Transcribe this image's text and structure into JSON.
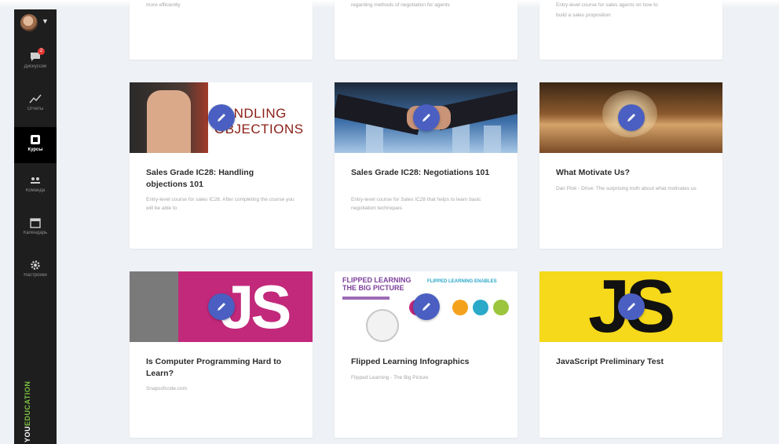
{
  "sidebar": {
    "notification_count": "2",
    "items": [
      {
        "label": "Дискуссии",
        "icon": "chat-bubble-icon"
      },
      {
        "label": "Отчеты",
        "icon": "chart-line-icon"
      },
      {
        "label": "Курсы",
        "icon": "courses-icon"
      },
      {
        "label": "Команда",
        "icon": "people-icon"
      },
      {
        "label": "Календарь",
        "icon": "calendar-icon"
      },
      {
        "label": "Настройки",
        "icon": "gear-icon"
      }
    ],
    "brand_part1": "YOU",
    "brand_part2": "EDUCATION"
  },
  "top_cards": [
    {
      "desc": "more efficiently"
    },
    {
      "desc": "regarding methods of negotiation for agents"
    },
    {
      "desc": "Entry-level course for sales agents on how to\nbuild a sales proposition"
    }
  ],
  "cards": [
    {
      "title": "Sales Grade IC28: Handling objections 101",
      "desc": "Entry-level course for sales IC28. After completing the course you will be able to",
      "thumb_text": "HANDLING\nOBJECTIONS"
    },
    {
      "title": "Sales Grade IC28: Negotiations 101",
      "desc": "Entry-level course for Sales IC28 that helps to learn basic negotiation techniques"
    },
    {
      "title": "What Motivate Us?",
      "desc": "Dan Pink - Drive: The surprising truth about what motivates us"
    },
    {
      "title": "Is Computer Programming Hard to Learn?",
      "desc": "Snapsofcode.com",
      "thumb_text": "JS"
    },
    {
      "title": "Flipped Learning Infographics",
      "desc": "Flipped Learning - The Big Picture",
      "thumb_heading": "FLIPPED LEARNING\nTHE BIG PICTURE",
      "thumb_subheading": "FLIPPED LEARNING ENABLES"
    },
    {
      "title": "JavaScript Preliminary Test",
      "desc": "",
      "thumb_text": "JS"
    }
  ],
  "colors": {
    "accent_button": "#4a5fc1",
    "sidebar_bg": "#1e1e1e",
    "brand_green": "#7cc242"
  }
}
